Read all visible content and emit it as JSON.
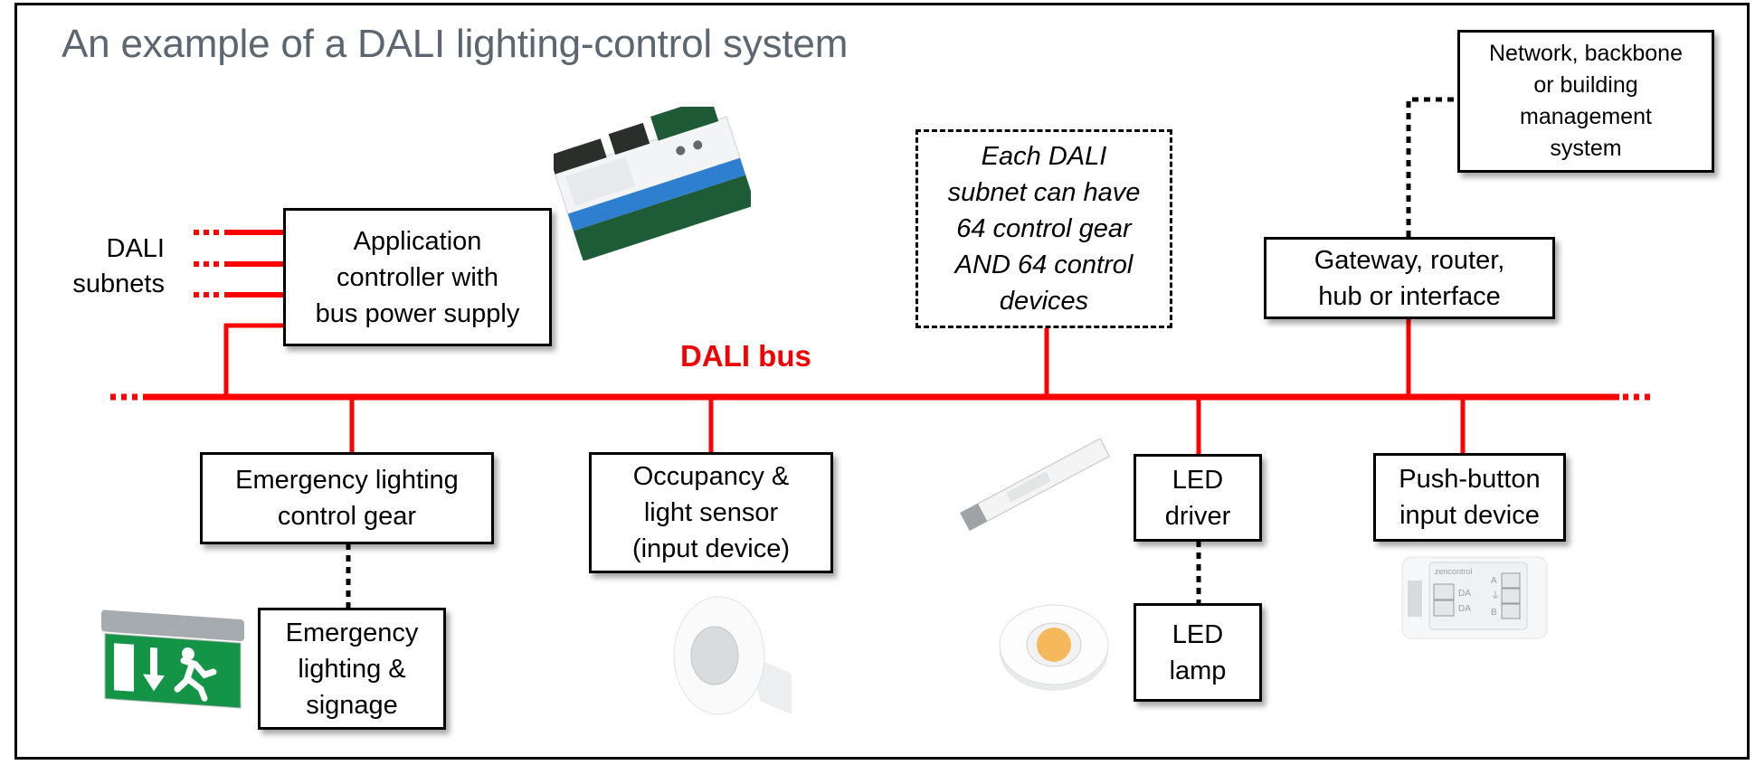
{
  "title": "An example of a DALI lighting-control system",
  "bus_label": "DALI bus",
  "subnets_label": "DALI\nsubnets",
  "colors": {
    "bus": "#ff0000",
    "title": "#5b6670",
    "border": "#000000"
  },
  "nodes": {
    "app_controller": "Application\ncontroller with\nbus power supply",
    "subnet_note": "Each DALI\nsubnet can have\n64 control gear\nAND 64 control\ndevices",
    "network": "Network, backbone\nor building\nmanagement\nsystem",
    "gateway": "Gateway, router,\nhub or interface",
    "emergency_gear": "Emergency lighting\ncontrol gear",
    "emergency_signage": "Emergency\nlighting &\nsignage",
    "occupancy_sensor": "Occupancy &\nlight sensor\n(input device)",
    "led_driver": "LED\ndriver",
    "led_lamp": "LED\nlamp",
    "push_button": "Push-button\ninput device"
  },
  "images": {
    "controller_photo": "controller-module-photo",
    "exit_sign_photo": "emergency-exit-sign-photo",
    "sensor_photo": "ceiling-sensor-photo",
    "driver_photo": "led-driver-photo",
    "lamp_photo": "led-module-photo",
    "push_button_photo": "push-button-interface-photo",
    "push_button_brand": "zencontrol",
    "push_button_terminals": [
      "DA",
      "DA",
      "A",
      "⏚",
      "B"
    ]
  }
}
